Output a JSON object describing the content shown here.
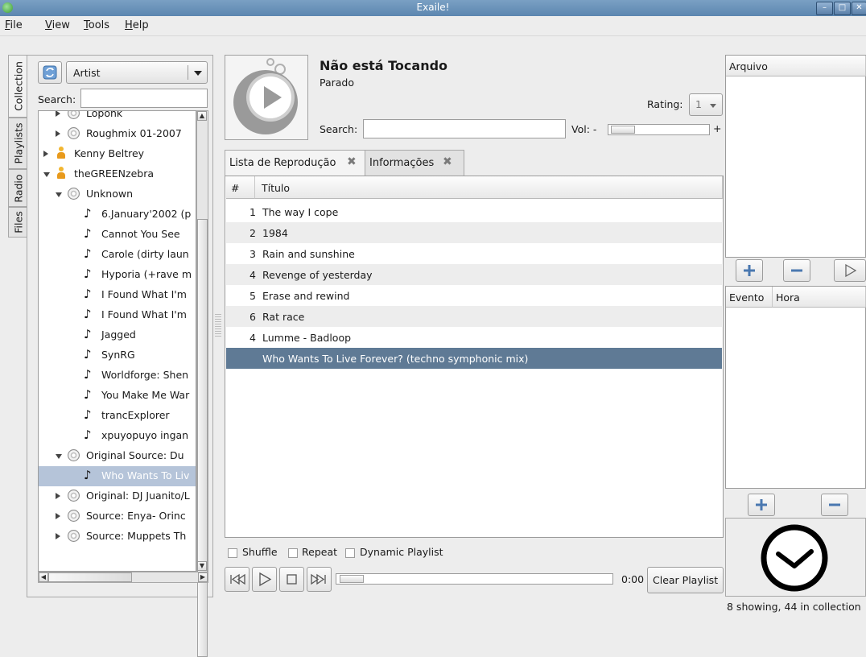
{
  "window": {
    "title": "Exaile!"
  },
  "menu": [
    {
      "label": "File",
      "mn": "F",
      "rest": "ile"
    },
    {
      "label": "View",
      "mn": "V",
      "rest": "iew"
    },
    {
      "label": "Tools",
      "mn": "T",
      "rest": "ools"
    },
    {
      "label": "Help",
      "mn": "H",
      "rest": "elp"
    }
  ],
  "side_tabs": [
    "Collection",
    "Playlists",
    "Radio",
    "Files"
  ],
  "collection": {
    "view_by": "Artist",
    "search_label": "Search:",
    "search_value": "",
    "tree": [
      {
        "level": 1,
        "kind": "album",
        "expander": "closed",
        "label": "Loponk",
        "clipped": true
      },
      {
        "level": 1,
        "kind": "album",
        "expander": "closed",
        "label": "Roughmix 01-2007"
      },
      {
        "level": 0,
        "kind": "artist",
        "expander": "closed",
        "label": "Kenny Beltrey"
      },
      {
        "level": 0,
        "kind": "artist",
        "expander": "open",
        "label": "theGREENzebra"
      },
      {
        "level": 1,
        "kind": "album",
        "expander": "open",
        "label": "Unknown"
      },
      {
        "level": 2,
        "kind": "track",
        "label": "6.January'2002 (p"
      },
      {
        "level": 2,
        "kind": "track",
        "label": "Cannot You See"
      },
      {
        "level": 2,
        "kind": "track",
        "label": "Carole (dirty laun"
      },
      {
        "level": 2,
        "kind": "track",
        "label": "Hyporia (+rave m"
      },
      {
        "level": 2,
        "kind": "track",
        "label": "I Found What I'm"
      },
      {
        "level": 2,
        "kind": "track",
        "label": "I Found What I'm"
      },
      {
        "level": 2,
        "kind": "track",
        "label": "Jagged"
      },
      {
        "level": 2,
        "kind": "track",
        "label": "SynRG"
      },
      {
        "level": 2,
        "kind": "track",
        "label": "Worldforge: Shen"
      },
      {
        "level": 2,
        "kind": "track",
        "label": "You Make Me War"
      },
      {
        "level": 2,
        "kind": "track",
        "label": "trancExplorer"
      },
      {
        "level": 2,
        "kind": "track",
        "label": "xpuyopuyo ingan"
      },
      {
        "level": 1,
        "kind": "album",
        "expander": "open",
        "label": "Original Source: Du"
      },
      {
        "level": 2,
        "kind": "track",
        "label": "Who Wants To Liv",
        "selected": true
      },
      {
        "level": 1,
        "kind": "album",
        "expander": "closed",
        "label": "Original: DJ Juanito/L"
      },
      {
        "level": 1,
        "kind": "album",
        "expander": "closed",
        "label": "Source: Enya- Orinc"
      },
      {
        "level": 1,
        "kind": "album",
        "expander": "closed",
        "label": "Source: Muppets Th"
      }
    ]
  },
  "now_playing": {
    "title": "Não está Tocando",
    "status": "Parado",
    "rating_label": "Rating:",
    "rating_value": "1",
    "search_label": "Search:",
    "search_value": "",
    "vol_label": "Vol: -",
    "vol_plus": "+"
  },
  "tabs": [
    {
      "label": "Lista de Reprodução",
      "active": true
    },
    {
      "label": "Informações",
      "active": false
    }
  ],
  "playlist": {
    "columns": [
      "#",
      "Título"
    ],
    "rows": [
      {
        "n": "1",
        "title": "The way I cope"
      },
      {
        "n": "2",
        "title": "1984"
      },
      {
        "n": "3",
        "title": "Rain and sunshine"
      },
      {
        "n": "4",
        "title": "Revenge of yesterday"
      },
      {
        "n": "5",
        "title": "Erase and rewind"
      },
      {
        "n": "6",
        "title": "Rat race"
      },
      {
        "n": "4",
        "title": "Lumme - Badloop"
      },
      {
        "n": "",
        "title": "Who Wants To Live Forever? (techno symphonic mix)",
        "selected": true
      }
    ]
  },
  "options": {
    "shuffle": "Shuffle",
    "repeat": "Repeat",
    "dynamic": "Dynamic Playlist"
  },
  "transport": {
    "time": "0:00",
    "clear": "Clear Playlist"
  },
  "right_panel": {
    "queue_header": "Arquivo",
    "events_headers": [
      "Evento",
      "Hora"
    ]
  },
  "statusbar": "8 showing, 44 in collection"
}
